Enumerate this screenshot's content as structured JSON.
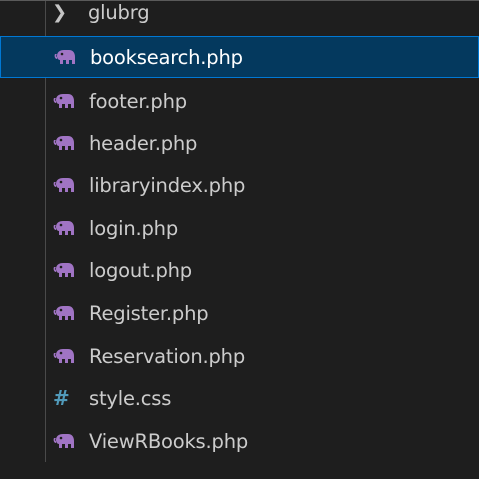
{
  "explorer": {
    "folder": {
      "label": "glubrg",
      "icon": "chevron-right-icon"
    },
    "files": [
      {
        "name": "booksearch.php",
        "icon": "php-elephant-icon",
        "selected": true
      },
      {
        "name": "footer.php",
        "icon": "php-elephant-icon"
      },
      {
        "name": "header.php",
        "icon": "php-elephant-icon"
      },
      {
        "name": "libraryindex.php",
        "icon": "php-elephant-icon"
      },
      {
        "name": "login.php",
        "icon": "php-elephant-icon"
      },
      {
        "name": "logout.php",
        "icon": "php-elephant-icon"
      },
      {
        "name": "Register.php",
        "icon": "php-elephant-icon"
      },
      {
        "name": "Reservation.php",
        "icon": "php-elephant-icon"
      },
      {
        "name": "style.css",
        "icon": "css-hash-icon",
        "icon_glyph": "#"
      },
      {
        "name": "ViewRBooks.php",
        "icon": "php-elephant-icon"
      }
    ],
    "colors": {
      "background": "#1e1e1e",
      "selection": "#04395e",
      "selection_border": "#0078d4",
      "text": "#cccccc",
      "php_icon": "#a074c4",
      "css_icon": "#519aba"
    }
  }
}
